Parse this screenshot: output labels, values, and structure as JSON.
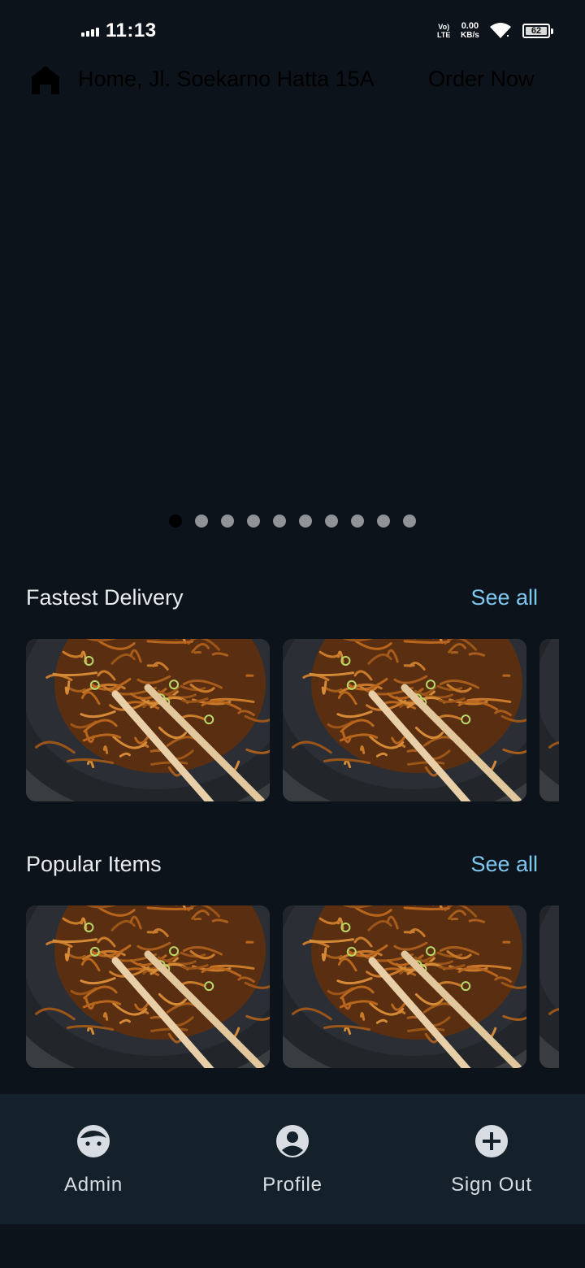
{
  "status_bar": {
    "time": "11:13",
    "volte_top": "Vo)",
    "volte_bottom": "LTE",
    "net_speed": "0.00",
    "net_unit": "KB/s",
    "battery": "62"
  },
  "header": {
    "address": "Home, Jl. Soekarno Hatta 15A",
    "order_now": "Order Now",
    "home_icon": "home-icon"
  },
  "carousel": {
    "dot_count": 10,
    "active_index": 0
  },
  "sections": {
    "fastest": {
      "title": "Fastest Delivery",
      "see_all": "See all"
    },
    "popular": {
      "title": "Popular Items",
      "see_all": "See all"
    }
  },
  "bottom_nav": {
    "items": [
      {
        "label": "Admin",
        "icon": "face-icon"
      },
      {
        "label": "Profile",
        "icon": "account-circle-icon"
      },
      {
        "label": "Sign Out",
        "icon": "add-circle-icon"
      }
    ]
  },
  "colors": {
    "background": "#0d131a",
    "accent": "#7ec8f0",
    "nav_background": "#15212a"
  }
}
